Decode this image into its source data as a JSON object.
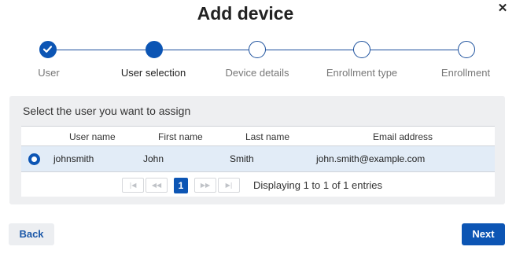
{
  "dialog": {
    "title": "Add device",
    "close_icon": "close-icon"
  },
  "stepper": {
    "steps": [
      {
        "label": "User",
        "state": "done"
      },
      {
        "label": "User selection",
        "state": "active"
      },
      {
        "label": "Device details",
        "state": "pending"
      },
      {
        "label": "Enrollment type",
        "state": "pending"
      },
      {
        "label": "Enrollment",
        "state": "pending"
      }
    ]
  },
  "panel": {
    "heading": "Select the user you want to assign",
    "columns": [
      "User name",
      "First name",
      "Last name",
      "Email address"
    ],
    "rows": [
      {
        "selected": true,
        "user_name": "johnsmith",
        "first_name": "John",
        "last_name": "Smith",
        "email": "john.smith@example.com"
      }
    ],
    "pagination": {
      "first_icon": "first-page-icon",
      "prev_icon": "prev-page-icon",
      "next_icon": "next-page-icon",
      "last_icon": "last-page-icon",
      "current_page": "1",
      "info": "Displaying 1 to 1 of 1 entries"
    }
  },
  "footer": {
    "back_label": "Back",
    "next_label": "Next"
  },
  "colors": {
    "primary": "#0c55b4",
    "selected_row": "#e2ecf7",
    "panel_bg": "#eeeff1"
  }
}
